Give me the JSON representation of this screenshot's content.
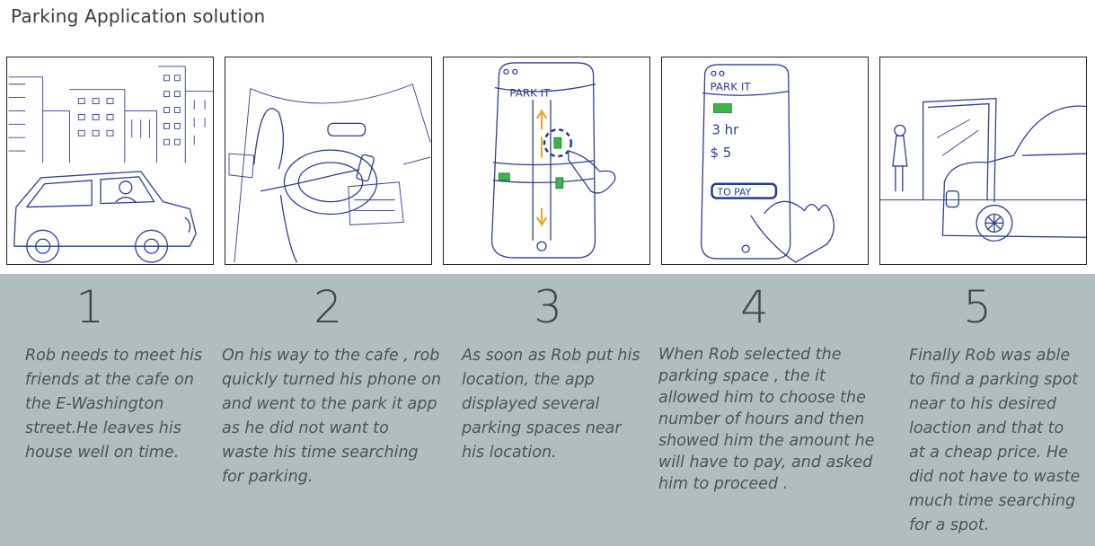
{
  "title": "Parking Application solution",
  "panels": [
    {
      "number": "1",
      "caption": "Rob needs to meet his\nfriends at the cafe on\nthe E-Washington\nstreet.He leaves his\nhouse well on time."
    },
    {
      "number": "2",
      "caption": "On his way to the cafe , rob\nquickly turned his phone on\nand went to the park it app\nas he did not want to\nwaste his time searching\nfor parking."
    },
    {
      "number": "3",
      "caption": "As soon as Rob put his\nlocation, the app\ndisplayed several\nparking spaces near\nhis location."
    },
    {
      "number": "4",
      "caption": "When Rob selected the\nparking space , the it\nallowed him to choose the\nnumber of hours and then\nshowed him the amount he\nwill have to pay, and asked\nhim to proceed ."
    },
    {
      "number": "5",
      "caption": "Finally Rob was able\nto find a parking spot\nnear to his desired\nloaction and that to\nat a cheap price. He\ndid not have to waste\nmuch time searching\nfor a spot."
    }
  ],
  "sketch_text": {
    "app_name_3": "PARK IT",
    "app_name_4": "PARK IT",
    "hours": "3 hr",
    "price": "$ 5",
    "pay_button": "TO PAY"
  },
  "colors": {
    "band": "#aebfbd",
    "ink": "#2a3f8f",
    "spot": "#3bb54a",
    "arrow": "#f0a21a"
  }
}
